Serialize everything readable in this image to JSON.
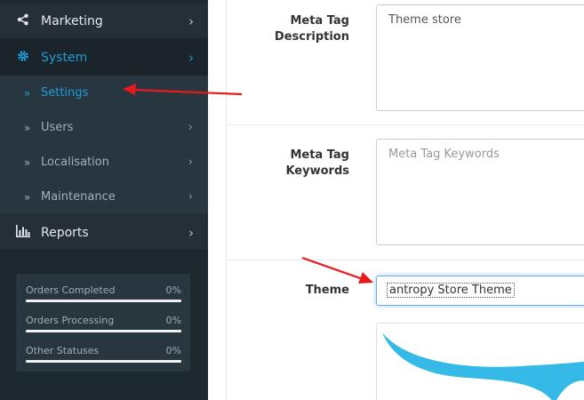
{
  "sidebar": {
    "menu": [
      {
        "label": "Marketing",
        "icon": "share-icon"
      },
      {
        "label": "System",
        "icon": "gear-icon",
        "active": true
      },
      {
        "label": "Settings",
        "active": true
      },
      {
        "label": "Users"
      },
      {
        "label": "Localisation"
      },
      {
        "label": "Maintenance"
      },
      {
        "label": "Reports",
        "icon": "bar-chart-icon"
      }
    ],
    "stats": [
      {
        "label": "Orders Completed",
        "percent": "0%",
        "fraction": 0
      },
      {
        "label": "Orders Processing",
        "percent": "0%",
        "fraction": 0
      },
      {
        "label": "Other Statuses",
        "percent": "0%",
        "fraction": 0
      }
    ]
  },
  "form": {
    "meta_description": {
      "label_line1": "Meta Tag",
      "label_line2": "Description",
      "value": "Theme store"
    },
    "meta_keywords": {
      "label_line1": "Meta Tag",
      "label_line2": "Keywords",
      "placeholder": "Meta Tag Keywords"
    },
    "theme": {
      "label": "Theme",
      "selected": "antropy Store Theme"
    }
  },
  "colors": {
    "accent": "#1e9ad6",
    "annotation_arrow": "#e8191c",
    "preview_swoosh": "#35b9e6"
  }
}
